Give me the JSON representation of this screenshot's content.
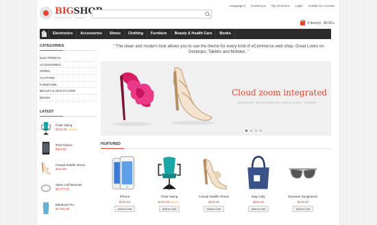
{
  "brand": {
    "name_a": "BIG",
    "name_b": "SHOP",
    "tagline": "OPENCART THEME"
  },
  "search": {
    "placeholder": "",
    "value": ""
  },
  "toplinks": {
    "language": "Language",
    "currency": "Currency",
    "account": "My Account",
    "login": "Login",
    "create": "Create An Account"
  },
  "cart": {
    "label": "0 item(s) - $0.00"
  },
  "nav": [
    "Electronics",
    "Accessories",
    "Shoes",
    "Clothing",
    "Furniture",
    "Beauty & Health Care",
    "Books"
  ],
  "categories_title": "CATEGORIES",
  "categories": [
    {
      "label": "ELECTRONICS",
      "has_children": true
    },
    {
      "label": "ACCESSORIES",
      "has_children": false
    },
    {
      "label": "SHOES",
      "has_children": true
    },
    {
      "label": "CLOTHING",
      "has_children": true
    },
    {
      "label": "FURNITURE",
      "has_children": false
    },
    {
      "label": "BEAUTY & HEALTH CARE",
      "has_children": false
    },
    {
      "label": "BOOKS",
      "has_children": true
    }
  ],
  "latest_title": "LATEST",
  "latest": [
    {
      "name": "Chair Swing",
      "price": "$235.99",
      "stars": 4,
      "icon": "chair"
    },
    {
      "name": "iPad Classic",
      "price": "$119.50",
      "stars": 0,
      "icon": "tablet"
    },
    {
      "name": "Casual Saddle Shoes",
      "price": "$119.50",
      "stars": 0,
      "icon": "shoe"
    },
    {
      "name": "Silver Cuff Bracelet",
      "price": "$1,177.00",
      "stars": 0,
      "icon": "bracelet"
    },
    {
      "name": "MacBook Pro",
      "price": "$2,000.00",
      "stars": 0,
      "icon": "shirt"
    }
  ],
  "tagline": "“ The clean and modern look allows you to  use the theme for every kind of eCommerce web shop. Great Looks on Desktops, Tablets and Mobiles. ”",
  "slider": {
    "title": "Cloud zoom integrated",
    "subtitle": "BIGSHOP RESPONSIVE OPEN CART THEME",
    "slide_count": 4,
    "active_index": 0
  },
  "featured_title": "FEATURED",
  "featured": [
    {
      "name": "iPhone",
      "price": "$120.50",
      "stars": 0,
      "icon": "phone"
    },
    {
      "name": "Chair Swing",
      "price": "$235.99",
      "stars": 4,
      "icon": "chair"
    },
    {
      "name": "Casual Saddle Shoes",
      "price": "$119.50",
      "stars": 0,
      "icon": "shoe"
    },
    {
      "name": "Bag Lady",
      "price": "$119.50",
      "stars": 0,
      "icon": "bag"
    },
    {
      "name": "Eyewear Eyeglasses",
      "price": "$119.50",
      "stars": 0,
      "icon": "glasses"
    }
  ],
  "add_to_cart": "Add to Cart",
  "colors": {
    "accent": "#e8412c",
    "nav_bg": "#2b2b2b",
    "stars": "#f0a500"
  }
}
